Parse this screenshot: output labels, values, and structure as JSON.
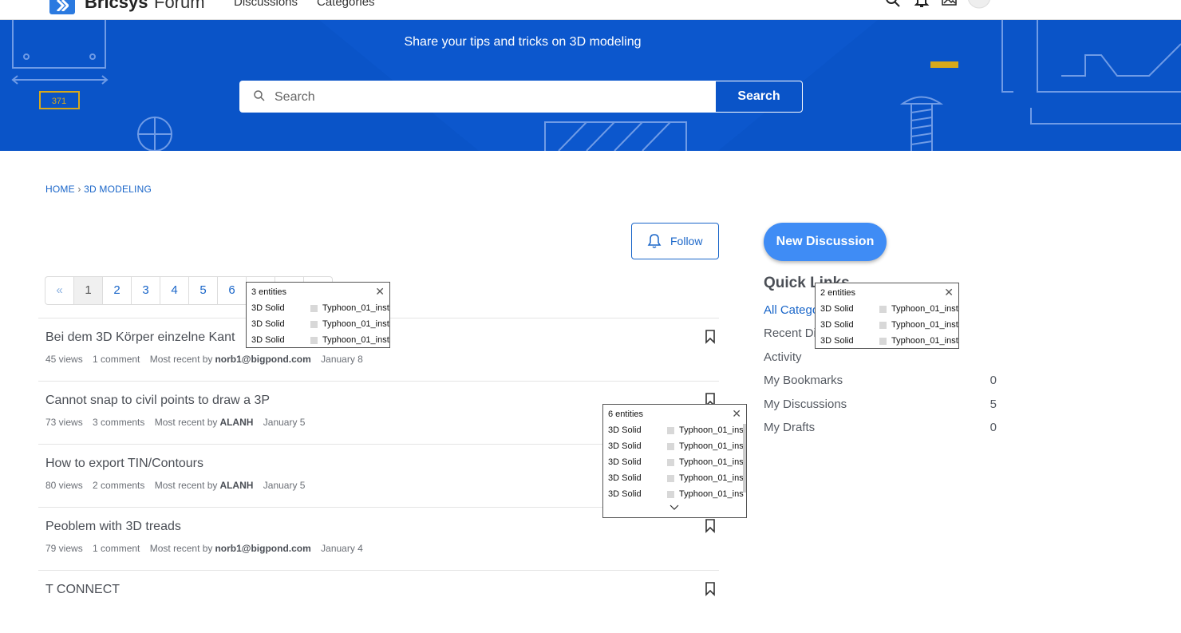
{
  "header": {
    "brand": "Bricsys",
    "brand_sub": "Forum",
    "nav": [
      "Discussions",
      "Categories"
    ],
    "icons": [
      "search-icon",
      "bell-icon",
      "image-icon",
      "avatar"
    ]
  },
  "hero": {
    "subtitle": "Share your tips and tricks on 3D modeling",
    "deco_label": "371"
  },
  "search": {
    "placeholder": "Search",
    "button": "Search"
  },
  "breadcrumb": {
    "home": "HOME",
    "sep": "›",
    "current": "3D MODELING"
  },
  "follow": {
    "label": "Follow"
  },
  "pager": {
    "prev": "«",
    "pages": [
      "1",
      "2",
      "3",
      "4",
      "5",
      "6"
    ]
  },
  "discussions": [
    {
      "title": "Bei dem 3D Körper einzelne Kant",
      "views": "45 views",
      "comments": "1 comment",
      "recent_prefix": "Most recent by",
      "user": "norb1@bigpond.com",
      "date": "January 8"
    },
    {
      "title": "Cannot snap to civil points to draw a 3P",
      "views": "73 views",
      "comments": "3 comments",
      "recent_prefix": "Most recent by",
      "user": "ALANH",
      "date": "January 5"
    },
    {
      "title": "How to export TIN/Contours",
      "views": "80 views",
      "comments": "2 comments",
      "recent_prefix": "Most recent by",
      "user": "ALANH",
      "date": "January 5"
    },
    {
      "title": "Peoblem with 3D treads",
      "views": "79 views",
      "comments": "1 comment",
      "recent_prefix": "Most recent by",
      "user": "norb1@bigpond.com",
      "date": "January 4"
    },
    {
      "title": "T CONNECT",
      "views": "",
      "comments": "",
      "recent_prefix": "",
      "user": "",
      "date": ""
    }
  ],
  "sidebar": {
    "new_discussion": "New Discussion",
    "quick_links_title": "Quick Links",
    "links": [
      {
        "label": "All Categories",
        "count": ""
      },
      {
        "label": "Recent Discussions",
        "count": ""
      },
      {
        "label": "Activity",
        "count": ""
      },
      {
        "label": "My Bookmarks",
        "count": "0"
      },
      {
        "label": "My Discussions",
        "count": "5"
      },
      {
        "label": "My Drafts",
        "count": "0"
      }
    ]
  },
  "popups": [
    {
      "header": "3 entities",
      "rows": [
        {
          "type": "3D Solid",
          "name": "Typhoon_01_inst"
        },
        {
          "type": "3D Solid",
          "name": "Typhoon_01_inst"
        },
        {
          "type": "3D Solid",
          "name": "Typhoon_01_inst"
        }
      ]
    },
    {
      "header": "2 entities",
      "rows": [
        {
          "type": "3D Solid",
          "name": "Typhoon_01_inst"
        },
        {
          "type": "3D Solid",
          "name": "Typhoon_01_inst"
        },
        {
          "type": "3D Solid",
          "name": "Typhoon_01_inst"
        }
      ]
    },
    {
      "header": "6 entities",
      "rows": [
        {
          "type": "3D Solid",
          "name": "Typhoon_01_ins"
        },
        {
          "type": "3D Solid",
          "name": "Typhoon_01_ins"
        },
        {
          "type": "3D Solid",
          "name": "Typhoon_01_ins"
        },
        {
          "type": "3D Solid",
          "name": "Typhoon_01_ins"
        },
        {
          "type": "3D Solid",
          "name": "Typhoon_01_ins"
        }
      ]
    }
  ],
  "colors": {
    "hero_bg": "#0a54c8",
    "link": "#1a66c9",
    "new_discussion": "#3f8cf5"
  }
}
